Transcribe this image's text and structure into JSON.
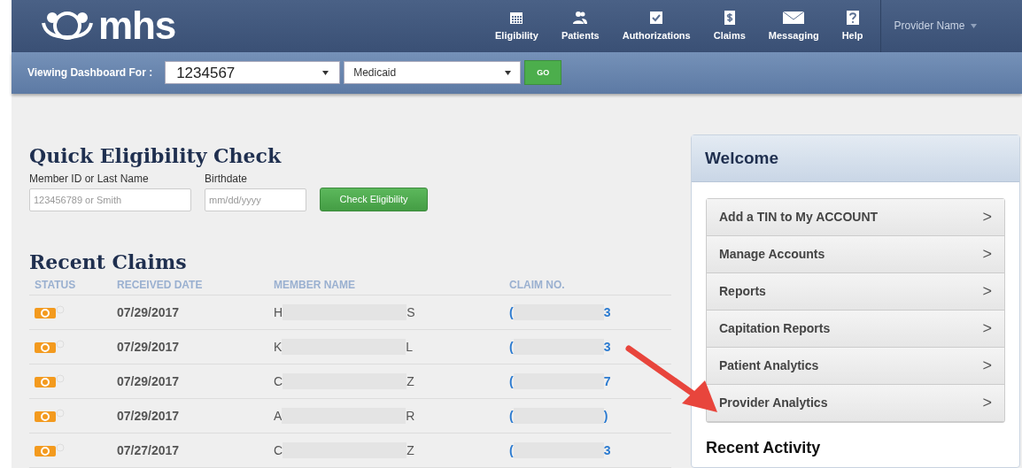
{
  "header": {
    "logo": "mhs",
    "nav": [
      {
        "label": "Eligibility"
      },
      {
        "label": "Patients"
      },
      {
        "label": "Authorizations"
      },
      {
        "label": "Claims"
      },
      {
        "label": "Messaging"
      },
      {
        "label": "Help"
      }
    ],
    "user_menu": "Provider Name"
  },
  "dashboard_bar": {
    "label": "Viewing Dashboard For :",
    "account": "1234567",
    "plan": "Medicaid",
    "go": "GO"
  },
  "eligibility": {
    "title": "Quick Eligibility Check",
    "fields": [
      {
        "label": "Member ID or Last Name",
        "placeholder": "123456789 or Smith"
      },
      {
        "label": "Birthdate",
        "placeholder": "mm/dd/yyyy"
      }
    ],
    "button": "Check Eligibility"
  },
  "claims": {
    "title": "Recent Claims",
    "columns": [
      "STATUS",
      "RECEIVED DATE",
      "MEMBER NAME",
      "CLAIM NO."
    ],
    "rows": [
      {
        "date": "07/29/2017",
        "name_start": "H",
        "name_end": "S",
        "claim_start": "(",
        "claim_end": "3"
      },
      {
        "date": "07/29/2017",
        "name_start": "K",
        "name_end": "L",
        "claim_start": "(",
        "claim_end": "3"
      },
      {
        "date": "07/29/2017",
        "name_start": "C",
        "name_end": "Z",
        "claim_start": "(",
        "claim_end": "7"
      },
      {
        "date": "07/29/2017",
        "name_start": "A",
        "name_end": "R",
        "claim_start": "(",
        "claim_end": ")"
      },
      {
        "date": "07/27/2017",
        "name_start": "C",
        "name_end": "Z",
        "claim_start": "(",
        "claim_end": "3"
      }
    ]
  },
  "welcome": {
    "title": "Welcome",
    "links": [
      {
        "label": "Add a TIN to My ACCOUNT",
        "chevron": ">"
      },
      {
        "label": "Manage Accounts",
        "chevron": ">"
      },
      {
        "label": "Reports",
        "chevron": ">"
      },
      {
        "label": "Capitation Reports",
        "chevron": ">"
      },
      {
        "label": "Patient Analytics",
        "chevron": ">"
      },
      {
        "label": "Provider Analytics",
        "chevron": ">"
      }
    ],
    "recent_activity": "Recent Activity"
  }
}
